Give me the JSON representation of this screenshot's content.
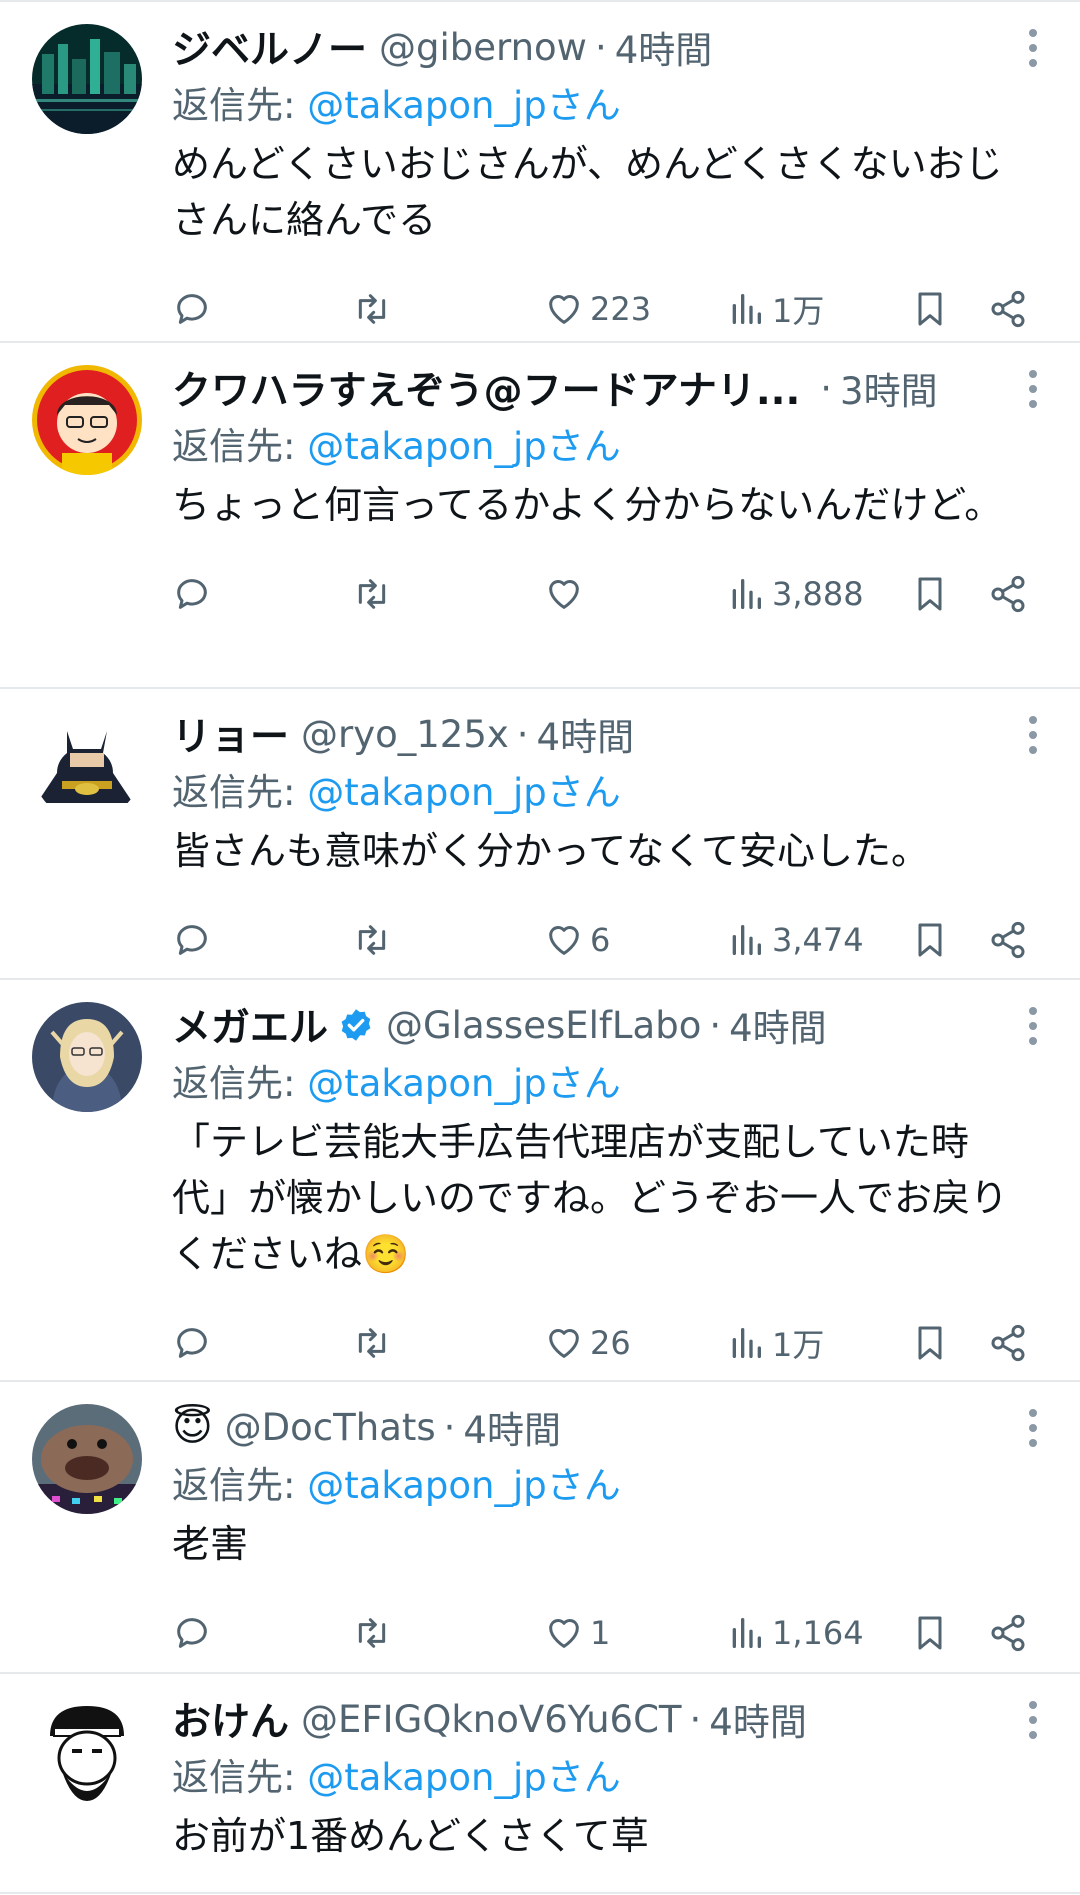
{
  "reply_prefix": "返信先: ",
  "reply_suffix": "さん",
  "tweets": [
    {
      "name": "ジベルノー",
      "handle": "@gibernow",
      "sep": "·",
      "time": "4時間",
      "reply_to": "@takapon_jp",
      "text": "めんどくさいおじさんが、めんどくさくないおじさんに絡んでる",
      "likes": "223",
      "views": "1万"
    },
    {
      "name": "クワハラすえぞう@フードアナリ...",
      "handle": "",
      "sep": "·",
      "time": "3時間",
      "reply_to": "@takapon_jp",
      "text": "ちょっと何言ってるかよく分からないんだけど。",
      "likes": "",
      "views": "3,888"
    },
    {
      "name": "リョー",
      "handle": "@ryo_125x",
      "sep": "·",
      "time": "4時間",
      "reply_to": "@takapon_jp",
      "text": "皆さんも意味がく分かってなくて安心した。",
      "likes": "6",
      "views": "3,474"
    },
    {
      "name": "メガエル",
      "handle": "@GlassesElfLabo",
      "sep": "·",
      "time": "4時間",
      "reply_to": "@takapon_jp",
      "text": "「テレビ芸能大手広告代理店が支配していた時代」が懐かしいのですね。どうぞお一人でお戻りくださいね☺️",
      "likes": "26",
      "views": "1万",
      "verified": true
    },
    {
      "name": "😇",
      "handle": "@DocThats",
      "sep": "·",
      "time": "4時間",
      "reply_to": "@takapon_jp",
      "text": "老害",
      "likes": "1",
      "views": "1,164"
    },
    {
      "name": "おけん",
      "handle": "@EFIGQknoV6Yu6CT",
      "sep": "·",
      "time": "4時間",
      "reply_to": "@takapon_jp",
      "text": "お前が1番めんどくさくて草",
      "likes": "",
      "views": ""
    }
  ],
  "colors": {
    "accent": "#1d9bf0",
    "secondary": "#536471",
    "text": "#0f1419",
    "verified": "#1d9bf0"
  }
}
